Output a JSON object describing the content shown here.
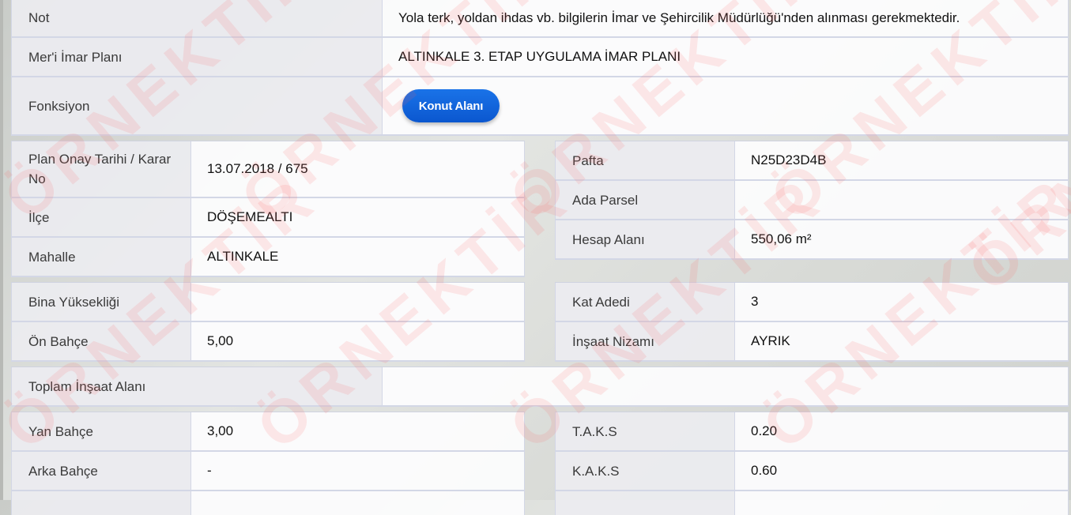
{
  "top_table": [
    {
      "label": "Not",
      "value": "Yola terk, yoldan ihdas vb. bilgilerin İmar ve Şehircilik Müdürlüğü'nden alınması gerekmektedir."
    },
    {
      "label": "Mer'i İmar Planı",
      "value": "ALTINKALE 3. ETAP UYGULAMA İMAR PLANI"
    },
    {
      "label": "Fonksiyon",
      "button": "Konut Alanı"
    }
  ],
  "plan_left": [
    {
      "label": "Plan Onay Tarihi / Karar No",
      "value": "13.07.2018 / 675"
    },
    {
      "label": "İlçe",
      "value": "DÖŞEMEALTI"
    },
    {
      "label": "Mahalle",
      "value": "ALTINKALE"
    }
  ],
  "plan_right": [
    {
      "label": "Pafta",
      "value": "N25D23D4B"
    },
    {
      "label": "Ada Parsel",
      "value": ""
    },
    {
      "label": "Hesap Alanı",
      "value": "550,06 m²"
    }
  ],
  "build_left": [
    {
      "label": "Bina Yüksekliği",
      "value": ""
    },
    {
      "label": "Ön Bahçe",
      "value": "5,00"
    }
  ],
  "build_right": [
    {
      "label": "Kat Adedi",
      "value": "3"
    },
    {
      "label": "İnşaat Nizamı",
      "value": "AYRIK"
    }
  ],
  "total": {
    "label": "Toplam İnşaat Alanı",
    "value": ""
  },
  "bottom_left": [
    {
      "label": "Yan Bahçe",
      "value": "3,00"
    },
    {
      "label": "Arka Bahçe",
      "value": "-"
    }
  ],
  "bottom_right": [
    {
      "label": "T.A.K.S",
      "value": "0.20"
    },
    {
      "label": "K.A.K.S",
      "value": "0.60"
    }
  ],
  "watermark": "ÖRNEKTİR",
  "colors": {
    "button": "#1a73e8",
    "watermark": "#ff5a5a"
  }
}
